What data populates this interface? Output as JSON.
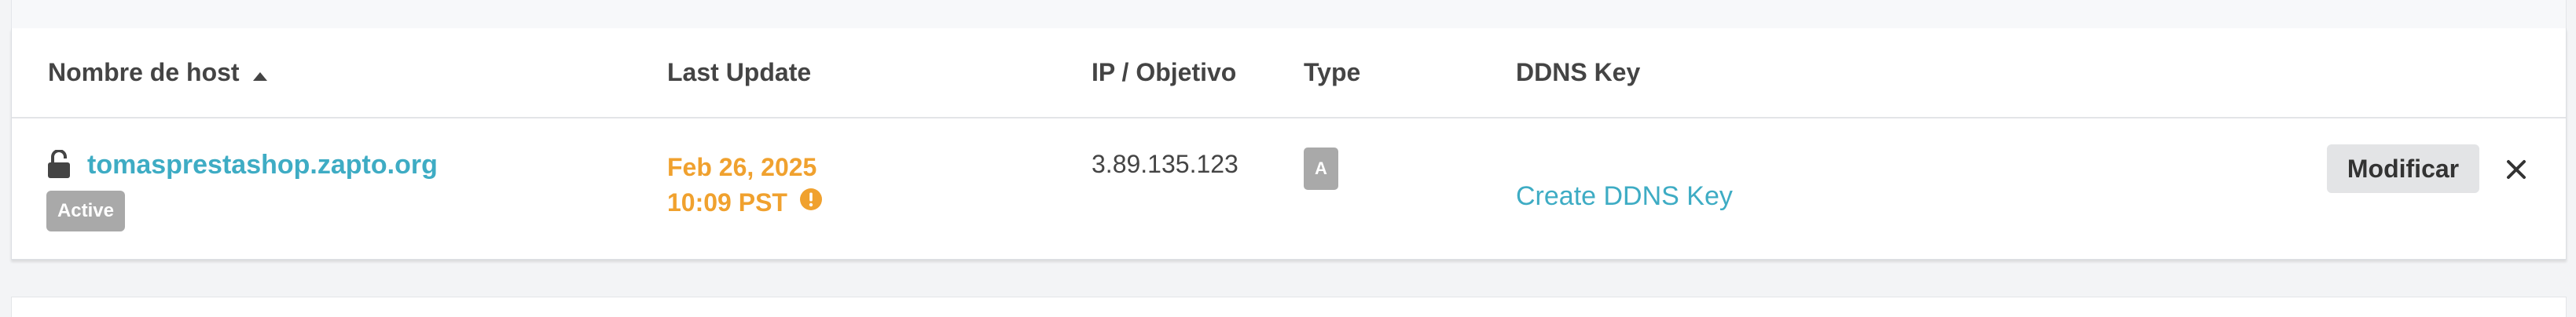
{
  "table": {
    "headers": {
      "hostname": "Nombre de host",
      "last_update": "Last Update",
      "ip": "IP / Objetivo",
      "type": "Type",
      "ddns_key": "DDNS Key"
    },
    "rows": [
      {
        "hostname": "tomasprestashop.zapto.org",
        "status": "Active",
        "last_update_date": "Feb 26, 2025",
        "last_update_time": "10:09 PST",
        "ip": "3.89.135.123",
        "type": "A",
        "ddns_key_link": "Create DDNS Key",
        "modify_label": "Modificar"
      }
    ]
  },
  "icons": {
    "sort": "sort-ascending-icon",
    "lock": "unlocked-padlock-icon",
    "warning": "exclamation-circle-icon",
    "close": "close-icon"
  },
  "colors": {
    "link": "#3eacc4",
    "warning": "#f0a12e",
    "badge": "#a9a9a9",
    "button": "#e3e4e6"
  }
}
